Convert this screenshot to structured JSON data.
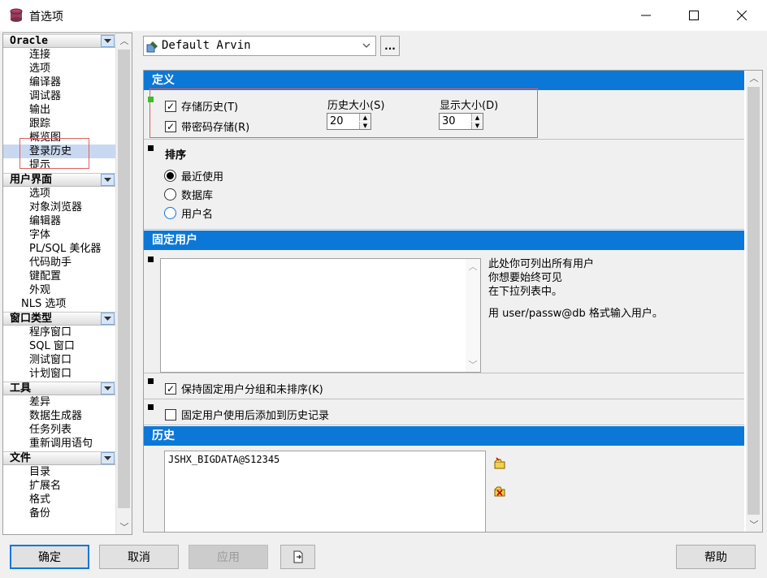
{
  "window": {
    "title": "首选项",
    "min_label": "—",
    "max_label": "☐",
    "close_label": "✕"
  },
  "tree": {
    "categories": [
      {
        "label": "Oracle",
        "items": [
          "连接",
          "选项",
          "编译器",
          "调试器",
          "输出",
          "跟踪",
          "概览图",
          "登录历史",
          "提示"
        ]
      },
      {
        "label": "用户界面",
        "items": [
          "选项",
          "对象浏览器",
          "编辑器",
          "字体",
          "PL/SQL 美化器",
          "代码助手",
          "键配置",
          "外观",
          "NLS 选项"
        ]
      },
      {
        "label": "窗口类型",
        "items": [
          "程序窗口",
          "SQL 窗口",
          "测试窗口",
          "计划窗口"
        ]
      },
      {
        "label": "工具",
        "items": [
          "差异",
          "数据生成器",
          "任务列表",
          "重新调用语句"
        ]
      },
      {
        "label": "文件",
        "items": [
          "目录",
          "扩展名",
          "格式",
          "备份"
        ]
      }
    ],
    "selected": "登录历史"
  },
  "profile": {
    "value": "Default Arvin",
    "more_label": "..."
  },
  "sections": {
    "definition": {
      "title": "定义",
      "store_history": {
        "label": "存储历史(T)",
        "checked": true
      },
      "store_with_password": {
        "label": "带密码存储(R)",
        "checked": true
      },
      "history_size_label": "历史大小(S)",
      "history_size_value": "20",
      "display_size_label": "显示大小(D)",
      "display_size_value": "30"
    },
    "sort": {
      "title": "排序",
      "options": [
        "最近使用",
        "数据库",
        "用户名"
      ],
      "selected": "最近使用"
    },
    "fixed_users": {
      "title": "固定用户",
      "hint_lines": [
        "此处你可列出所有用户",
        "你想要始终可见",
        "在下拉列表中。"
      ],
      "hint_format": "用 user/passw@db 格式输入用户。",
      "keep_group": {
        "label": "保持固定用户分组和未排序(K)",
        "checked": true
      },
      "add_to_history": {
        "label": "固定用户使用后添加到历史记录",
        "checked": false
      }
    },
    "history": {
      "title": "历史",
      "entries": [
        "JSHX_BIGDATA@S12345"
      ]
    }
  },
  "buttons": {
    "ok": "确定",
    "cancel": "取消",
    "apply": "应用",
    "help": "帮助"
  },
  "colors": {
    "accent": "#0b78d7",
    "highlight_box": "#e06060",
    "selected_item": "#c8d8f0"
  }
}
